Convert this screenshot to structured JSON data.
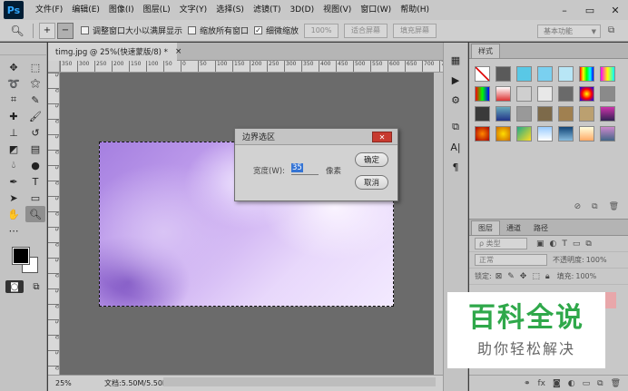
{
  "app": {
    "logo": "Ps",
    "menu": [
      "文件(F)",
      "编辑(E)",
      "图像(I)",
      "图层(L)",
      "文字(Y)",
      "选择(S)",
      "滤镜(T)",
      "3D(D)",
      "视图(V)",
      "窗口(W)",
      "帮助(H)"
    ],
    "window_controls": [
      "minimize-icon",
      "maximize-icon",
      "close-icon"
    ]
  },
  "options": {
    "tool_icon": "zoom-icon",
    "zoom_in_icon": "zoom-in-icon",
    "zoom_out_icon": "zoom-out-icon",
    "resize_windows": "调整窗口大小以满屏显示",
    "zoom_all": "缩放所有窗口",
    "scrubby": "细微缩放",
    "percent": "100%",
    "fit_screen": "适合屏幕",
    "fill_screen": "填充屏幕",
    "workspace": "基本功能"
  },
  "document": {
    "tab_title": "timg.jpg @ 25%(快速蒙版/8) *",
    "tab_close": "×",
    "zoom": "25%",
    "doc_info": "文档:5.50M/5.50M",
    "ruler_top": [
      "350",
      "300",
      "250",
      "200",
      "150",
      "100",
      "50",
      "0",
      "50",
      "100",
      "150",
      "200",
      "250",
      "300",
      "350",
      "400",
      "450",
      "500",
      "550",
      "600",
      "650",
      "700",
      "750"
    ],
    "ruler_left": [
      "5",
      "0",
      "5",
      "0",
      "5",
      "0",
      "5",
      "0",
      "5",
      "0",
      "5",
      "0",
      "5",
      "0",
      "5",
      "0",
      "5",
      "0",
      "5",
      "0"
    ]
  },
  "dialog": {
    "title": "边界选区",
    "close": "✕",
    "width_label": "宽度(W):",
    "width_value": "35",
    "unit": "像素",
    "ok": "确定",
    "cancel": "取消"
  },
  "panels": {
    "styles_tab": "样式",
    "layers_tabs": [
      "图层",
      "通道",
      "路径"
    ],
    "kind_filter": "ρ 类型",
    "blend_mode": "正常",
    "opacity_label": "不透明度:",
    "opacity_value": "100%",
    "lock_label": "锁定:",
    "fill_label": "填充:",
    "fill_value": "100%"
  },
  "watermark": {
    "title": "百科全说",
    "subtitle": "助你轻松解决"
  },
  "colors": {
    "menubar": "#c8c8c8",
    "canvas": "#6b6b6b",
    "accent_green": "#2fa84a",
    "selection_blue": "#3574d4",
    "close_red": "#c73a2f"
  }
}
